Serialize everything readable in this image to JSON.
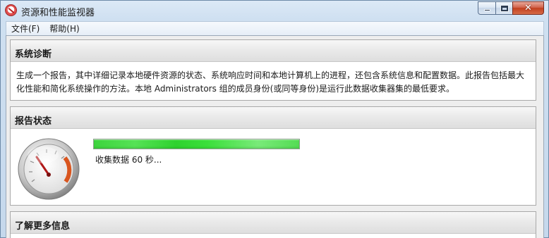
{
  "window": {
    "title": "资源和性能监视器"
  },
  "menubar": {
    "items": [
      "文件(F)",
      "帮助(H)"
    ]
  },
  "sections": {
    "diagnosis": {
      "title": "系统诊断",
      "description": "生成一个报告，其中详细记录本地硬件资源的状态、系统响应时间和本地计算机上的进程，还包含系统信息和配置数据。此报告包括最大化性能和简化系统操作的方法。本地 Administrators 组的成员身份(或同等身份)是运行此数据收集器集的最低要求。"
    },
    "report_status": {
      "title": "报告状态",
      "progress_fraction": 1.0,
      "status_text": "收集数据 60 秒..."
    },
    "learn_more": {
      "title": "了解更多信息"
    }
  },
  "icons": {
    "app": "performance-monitor-icon",
    "gauge": "speedometer-gauge-icon",
    "minimize": "minimize-icon",
    "maximize": "maximize-icon",
    "close": "close-icon"
  },
  "colors": {
    "progress": "#3ed43e",
    "close_button": "#c2401f"
  }
}
